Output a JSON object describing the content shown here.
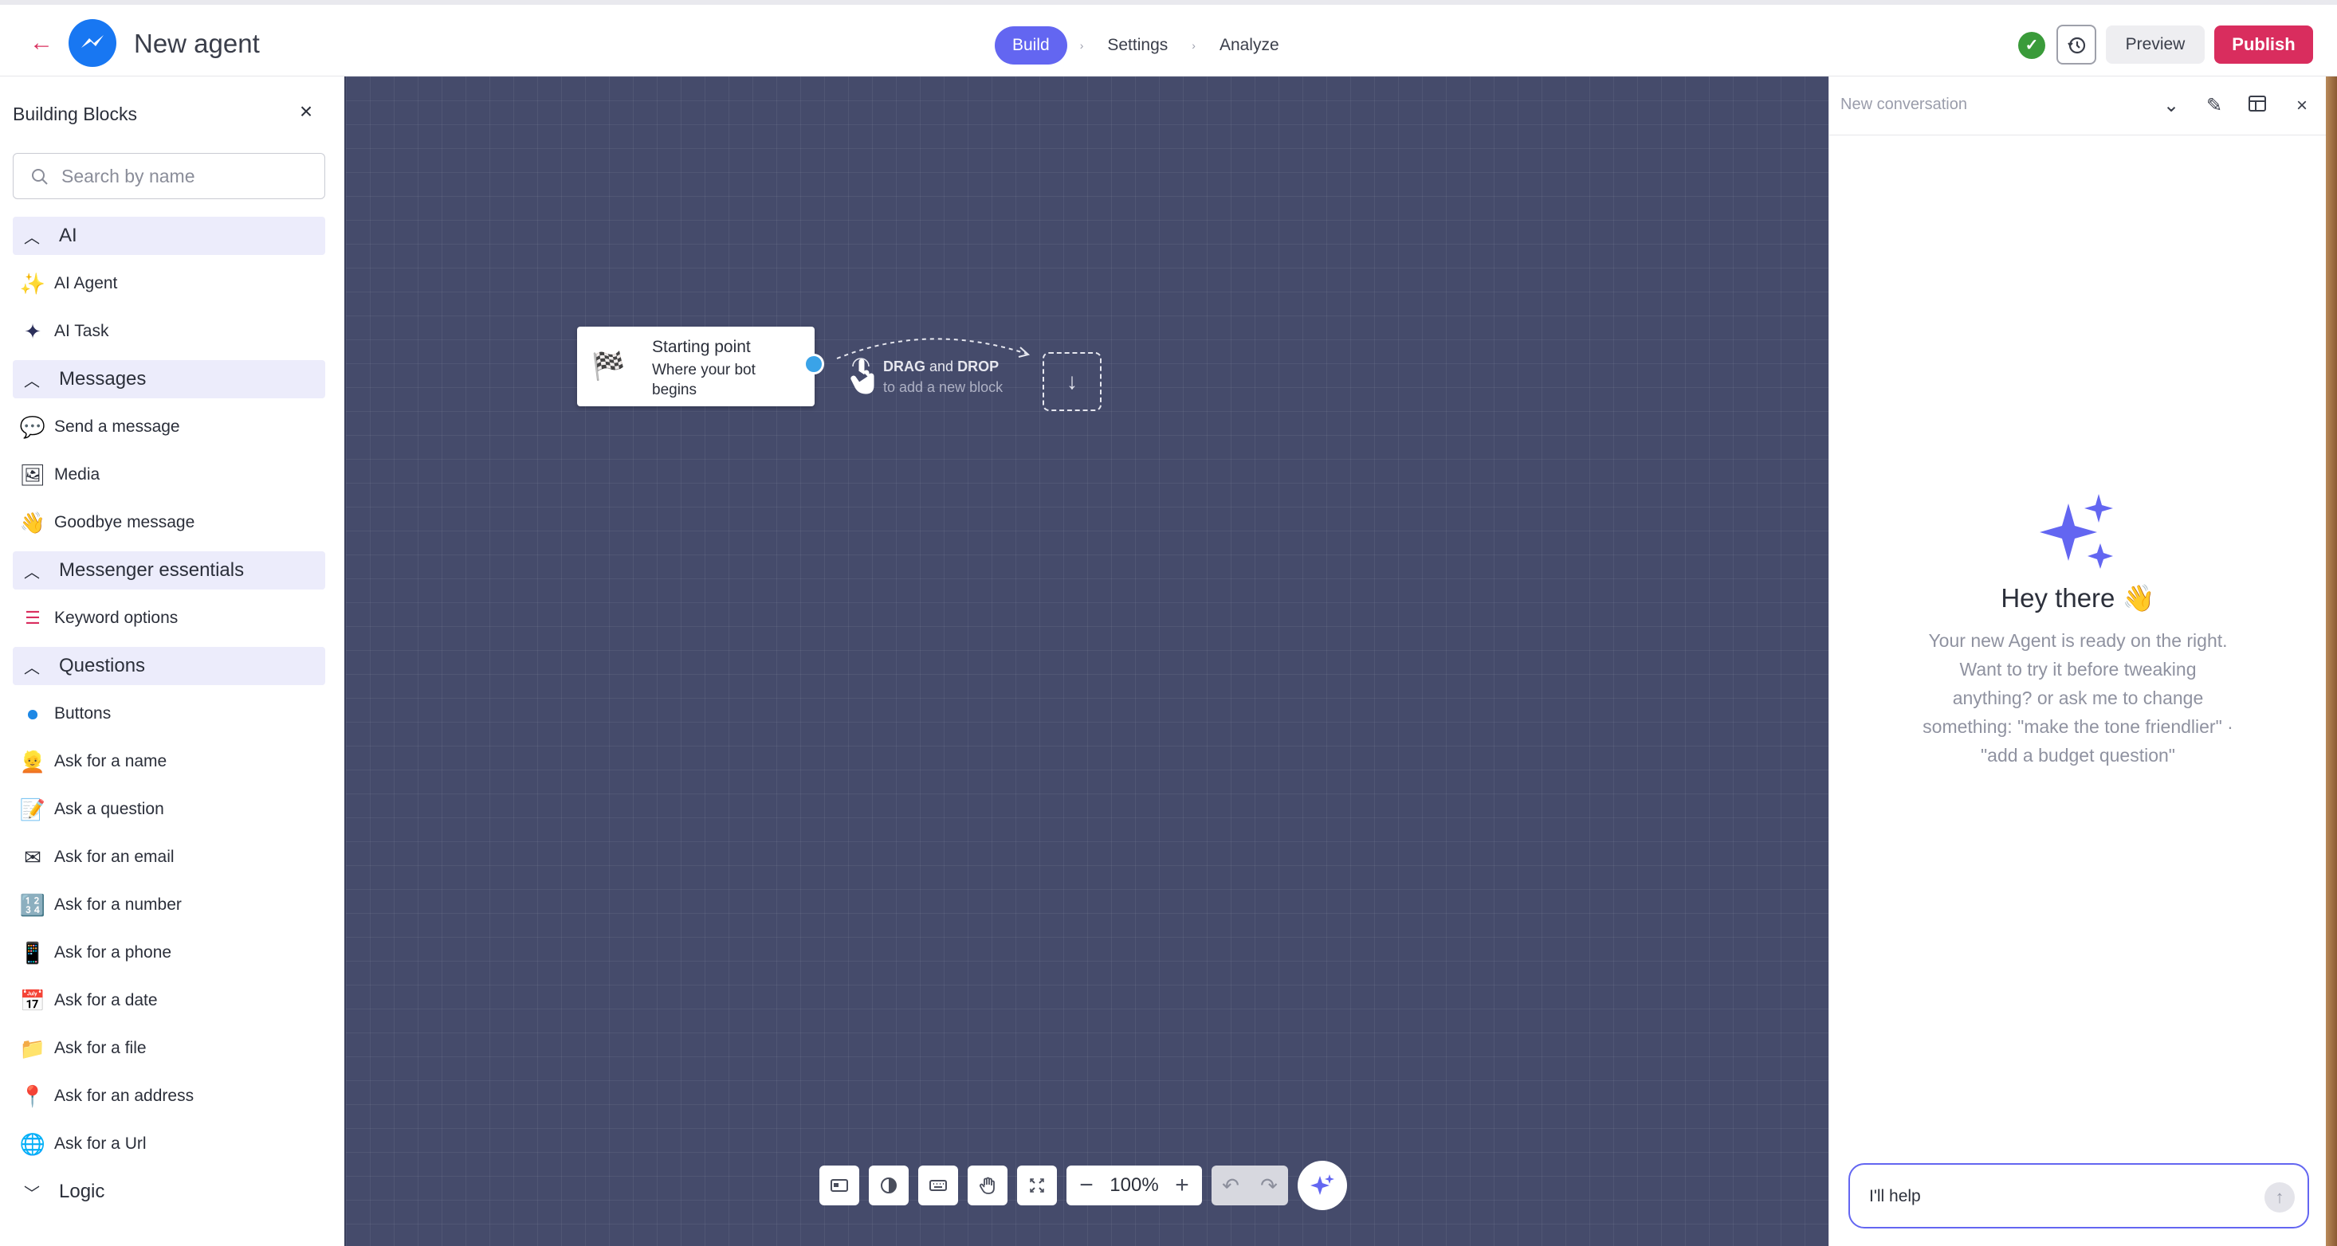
{
  "header": {
    "back_icon": "arrow-left-icon",
    "brand_icon": "messenger-logo-icon",
    "title": "New agent",
    "steps": [
      "Build",
      "Settings",
      "Analyze"
    ],
    "active_step": "Build",
    "preview_label": "Preview",
    "publish_label": "Publish",
    "colors": {
      "accent": "#6366f1",
      "publish": "#d92d5e",
      "ok": "#3a9b3a"
    }
  },
  "sidebar": {
    "title": "Building Blocks",
    "search_placeholder": "Search by name",
    "groups": [
      {
        "label": "AI",
        "items": [
          {
            "label": "AI Agent",
            "icon": "sparkles-icon"
          },
          {
            "label": "AI Task",
            "icon": "sparkle-task-icon"
          }
        ]
      },
      {
        "label": "Messages",
        "items": [
          {
            "label": "Send a message",
            "icon": "speech-bubble-icon"
          },
          {
            "label": "Media",
            "icon": "media-icon"
          },
          {
            "label": "Goodbye message",
            "icon": "waving-hand-icon"
          }
        ]
      },
      {
        "label": "Messenger essentials",
        "items": [
          {
            "label": "Keyword options",
            "icon": "numbered-list-icon"
          }
        ]
      },
      {
        "label": "Questions",
        "items": [
          {
            "label": "Buttons",
            "icon": "button-icon"
          },
          {
            "label": "Ask for a name",
            "icon": "person-icon"
          },
          {
            "label": "Ask a question",
            "icon": "memo-icon"
          },
          {
            "label": "Ask for an email",
            "icon": "envelope-icon"
          },
          {
            "label": "Ask for a number",
            "icon": "numbers-icon"
          },
          {
            "label": "Ask for a phone",
            "icon": "phone-icon"
          },
          {
            "label": "Ask for a date",
            "icon": "calendar-icon"
          },
          {
            "label": "Ask for a file",
            "icon": "folder-icon"
          },
          {
            "label": "Ask for an address",
            "icon": "pin-icon"
          },
          {
            "label": "Ask for a Url",
            "icon": "globe-icon"
          }
        ]
      },
      {
        "label": "Logic",
        "collapsed": true,
        "items": []
      }
    ]
  },
  "canvas": {
    "start_node": {
      "title": "Starting point",
      "subtitle": "Where your bot begins",
      "icon": "checkered-flag-icon"
    },
    "drag_hint": {
      "drag": "DRAG",
      "and": "and",
      "drop": "DROP",
      "sub": "to add a new block"
    },
    "zoom": "100%"
  },
  "chat": {
    "title": "New conversation",
    "greeting": "Hey there 👋",
    "body": "Your new Agent is ready on the right. Want to try it before tweaking anything? or ask me to change something: \"make the tone friendlier\" · \"add a budget question\"",
    "input_value": "I'll help"
  }
}
